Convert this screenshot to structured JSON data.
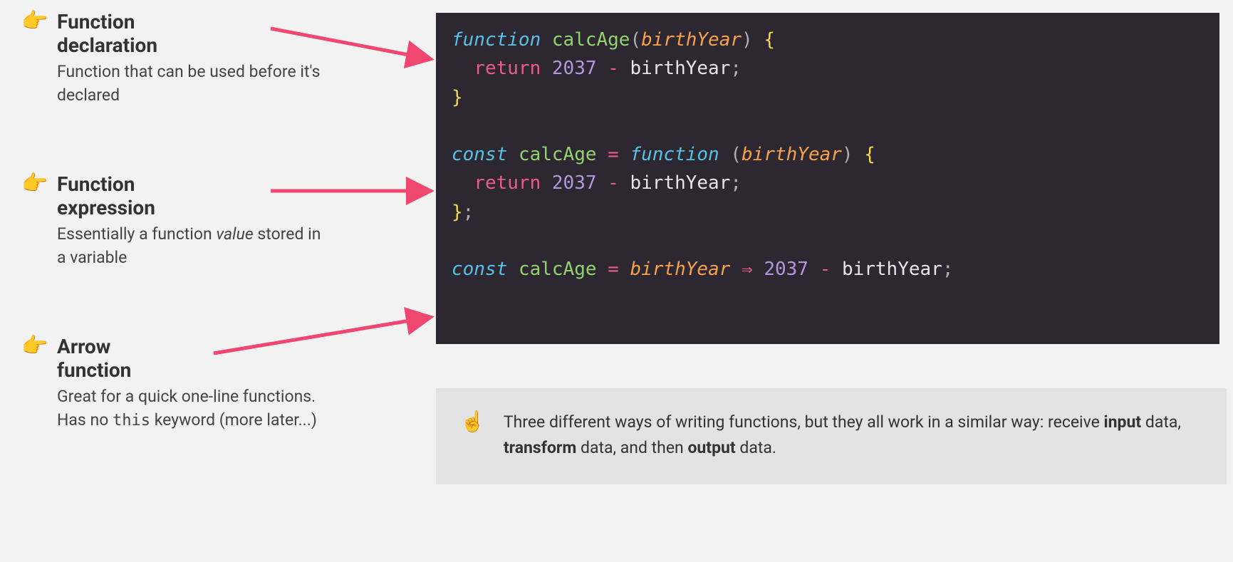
{
  "items": [
    {
      "icon": "👉",
      "title": "Function declaration",
      "desc_before": "Function that can be used before it's declared",
      "desc_after": ""
    },
    {
      "icon": "👉",
      "title": "Function expression",
      "desc_before": "Essentially a function ",
      "desc_em": "value",
      "desc_after": " stored in a variable"
    },
    {
      "icon": "👉",
      "title": "Arrow function",
      "desc_before": "Great for a quick one-line functions. Has no ",
      "desc_code": "this",
      "desc_after": " keyword (more later...)"
    }
  ],
  "code": {
    "line1": {
      "kw": "function",
      "name": "calcAge",
      "p_open": "(",
      "param": "birthYear",
      "p_close": ")",
      "brace": "{"
    },
    "line2": {
      "indent": "  ",
      "ret": "return",
      "num": "2037",
      "op": "-",
      "ident": "birthYear",
      "semi": ";"
    },
    "line3": {
      "brace": "}"
    },
    "line5": {
      "kw": "const",
      "name": "calcAge",
      "eq": "=",
      "fn": "function",
      "p_open": "(",
      "param": "birthYear",
      "p_close": ")",
      "brace": "{"
    },
    "line6": {
      "indent": "  ",
      "ret": "return",
      "num": "2037",
      "op": "-",
      "ident": "birthYear",
      "semi": ";"
    },
    "line7": {
      "brace": "}",
      "semi": ";"
    },
    "line9": {
      "kw": "const",
      "name": "calcAge",
      "eq": "=",
      "param": "birthYear",
      "arrow": "⇒",
      "num": "2037",
      "op": "-",
      "ident": "birthYear",
      "semi": ";"
    }
  },
  "note": {
    "icon": "☝️",
    "t1": "Three different ways of writing functions, but they all work in a similar way: receive ",
    "b1": "input",
    "t2": " data, ",
    "b2": "transform",
    "t3": " data, and then ",
    "b3": "output",
    "t4": " data."
  }
}
